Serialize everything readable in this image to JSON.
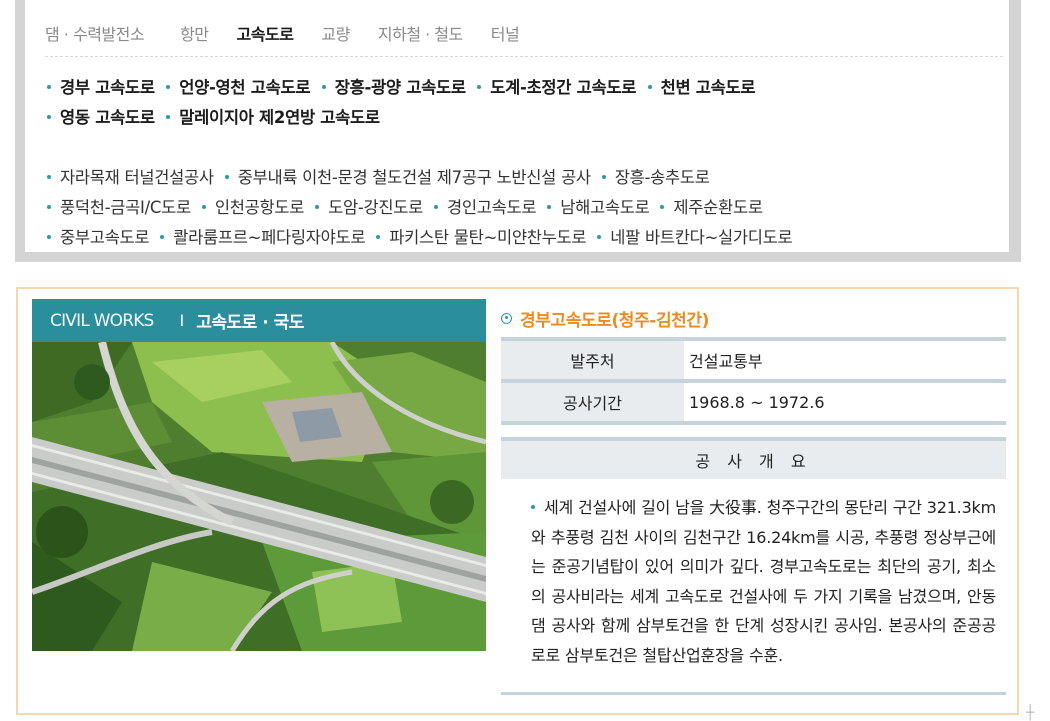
{
  "category_tabs": [
    {
      "label": "댐 · 수력발전소",
      "active": false
    },
    {
      "label": "항만",
      "active": false
    },
    {
      "label": "고속도로",
      "active": true
    },
    {
      "label": "교량",
      "active": false
    },
    {
      "label": "지하철 · 철도",
      "active": false
    },
    {
      "label": "터널",
      "active": false
    }
  ],
  "highway_projects": [
    [
      "경부 고속도로",
      "언양-영천 고속도로",
      "장흥-광양 고속도로",
      "도계-초정간 고속도로",
      "천변 고속도로"
    ],
    [
      "영동 고속도로",
      "말레이지아 제2연방 고속도로"
    ]
  ],
  "other_projects": [
    [
      "자라목재 터널건설공사",
      "중부내륙 이천-문경 철도건설 제7공구 노반신설 공사",
      "장흥-송추도로"
    ],
    [
      "풍덕천-금곡I/C도로",
      "인천공항도로",
      "도암-강진도로",
      "경인고속도로",
      "남해고속도로",
      "제주순환도로"
    ],
    [
      "중부고속도로",
      "콸라룸프르~페다링자야도로",
      "파키스탄 물탄~미얀찬누도로",
      "네팔 바트칸다~실가디도로"
    ]
  ],
  "photo_header": {
    "section": "CIVIL WORKS",
    "separator": "I",
    "category": "고속도로 · 국도"
  },
  "detail": {
    "title": "경부고속도로(청주-김천간)",
    "client_label": "발주처",
    "client_value": "건설교통부",
    "period_label": "공사기간",
    "period_value": "1968.8 ~ 1972.6",
    "overview_label": "공 사 개 요",
    "overview_text": "세계 건설사에 길이 남을 大役事. 청주구간의 몽단리 구간 321.3km와 추풍령 김천 사이의 김천구간 16.24km를 시공, 추풍령 정상부근에는 준공기념탑이 있어 의미가 깊다. 경부고속도로는 최단의 공기, 최소의 공사비라는 세계 고속도로 건설사에 두 가지 기록을 남겼으며, 안동댐 공사와 함께 삼부토건을 한 단계 성장시킨 공사임. 본공사의 준공공로로 삼부토건은 철탑산업훈장을 수훈."
  },
  "corner_mark": "┼",
  "colors": {
    "teal": "#2a8e9c",
    "orange": "#f08a1e",
    "frame_gray": "#d4d4d4",
    "frame_orange": "#f7d7b0",
    "table_bar": "#c5d3dc",
    "cell_bg": "#e8ecef"
  }
}
